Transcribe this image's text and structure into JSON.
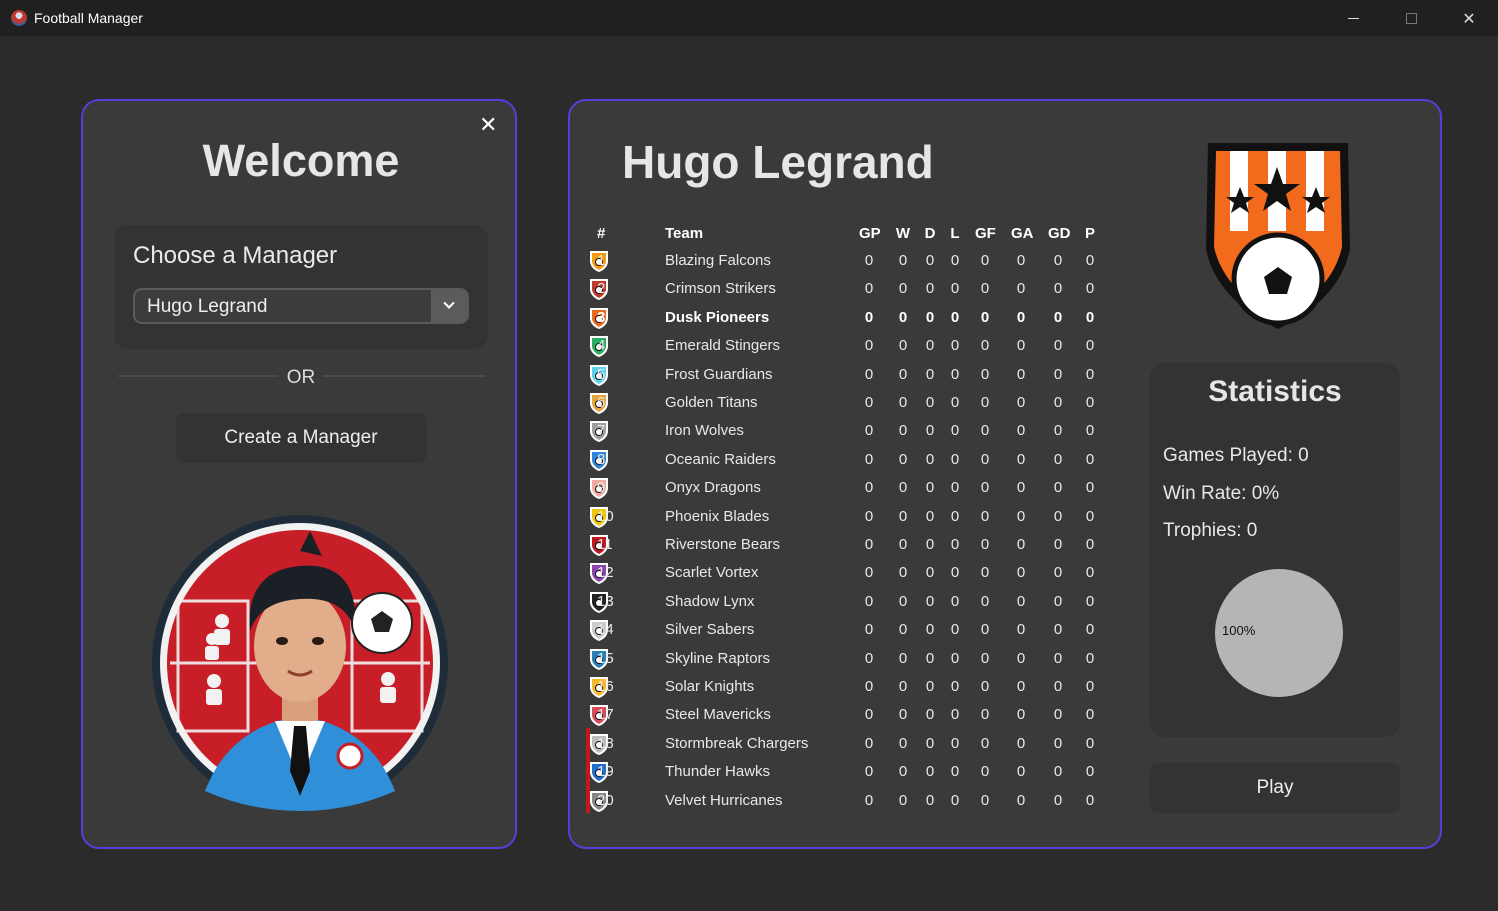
{
  "window": {
    "title": "Football Manager"
  },
  "welcome": {
    "heading": "Welcome",
    "choose_title": "Choose a Manager",
    "selected_manager": "Hugo Legrand",
    "or_text": "OR",
    "create_button": "Create a Manager"
  },
  "profile": {
    "manager_name": "Hugo Legrand",
    "table": {
      "headers": [
        "#",
        "Team",
        "GP",
        "W",
        "D",
        "L",
        "GF",
        "GA",
        "GD",
        "P"
      ],
      "rows": [
        {
          "pos": "1",
          "team": "Blazing Falcons",
          "gp": "0",
          "w": "0",
          "d": "0",
          "l": "0",
          "gf": "0",
          "ga": "0",
          "gd": "0",
          "p": "0",
          "color": "#f39c12"
        },
        {
          "pos": "2",
          "team": "Crimson Strikers",
          "gp": "0",
          "w": "0",
          "d": "0",
          "l": "0",
          "gf": "0",
          "ga": "0",
          "gd": "0",
          "p": "0",
          "color": "#c0392b"
        },
        {
          "pos": "3",
          "team": "Dusk Pioneers",
          "gp": "0",
          "w": "0",
          "d": "0",
          "l": "0",
          "gf": "0",
          "ga": "0",
          "gd": "0",
          "p": "0",
          "color": "#e8691f"
        },
        {
          "pos": "4",
          "team": "Emerald Stingers",
          "gp": "0",
          "w": "0",
          "d": "0",
          "l": "0",
          "gf": "0",
          "ga": "0",
          "gd": "0",
          "p": "0",
          "color": "#27ae60"
        },
        {
          "pos": "5",
          "team": "Frost Guardians",
          "gp": "0",
          "w": "0",
          "d": "0",
          "l": "0",
          "gf": "0",
          "ga": "0",
          "gd": "0",
          "p": "0",
          "color": "#5dd3f0"
        },
        {
          "pos": "6",
          "team": "Golden Titans",
          "gp": "0",
          "w": "0",
          "d": "0",
          "l": "0",
          "gf": "0",
          "ga": "0",
          "gd": "0",
          "p": "0",
          "color": "#e8a33d"
        },
        {
          "pos": "7",
          "team": "Iron Wolves",
          "gp": "0",
          "w": "0",
          "d": "0",
          "l": "0",
          "gf": "0",
          "ga": "0",
          "gd": "0",
          "p": "0",
          "color": "#9e9e9e"
        },
        {
          "pos": "8",
          "team": "Oceanic Raiders",
          "gp": "0",
          "w": "0",
          "d": "0",
          "l": "0",
          "gf": "0",
          "ga": "0",
          "gd": "0",
          "p": "0",
          "color": "#2e86de"
        },
        {
          "pos": "9",
          "team": "Onyx Dragons",
          "gp": "0",
          "w": "0",
          "d": "0",
          "l": "0",
          "gf": "0",
          "ga": "0",
          "gd": "0",
          "p": "0",
          "color": "#f1a9a0"
        },
        {
          "pos": "10",
          "team": "Phoenix Blades",
          "gp": "0",
          "w": "0",
          "d": "0",
          "l": "0",
          "gf": "0",
          "ga": "0",
          "gd": "0",
          "p": "0",
          "color": "#f1c40f"
        },
        {
          "pos": "11",
          "team": "Riverstone Bears",
          "gp": "0",
          "w": "0",
          "d": "0",
          "l": "0",
          "gf": "0",
          "ga": "0",
          "gd": "0",
          "p": "0",
          "color": "#c0181f"
        },
        {
          "pos": "12",
          "team": "Scarlet Vortex",
          "gp": "0",
          "w": "0",
          "d": "0",
          "l": "0",
          "gf": "0",
          "ga": "0",
          "gd": "0",
          "p": "0",
          "color": "#8e44ad"
        },
        {
          "pos": "13",
          "team": "Shadow Lynx",
          "gp": "0",
          "w": "0",
          "d": "0",
          "l": "0",
          "gf": "0",
          "ga": "0",
          "gd": "0",
          "p": "0",
          "color": "#222222"
        },
        {
          "pos": "14",
          "team": "Silver Sabers",
          "gp": "0",
          "w": "0",
          "d": "0",
          "l": "0",
          "gf": "0",
          "ga": "0",
          "gd": "0",
          "p": "0",
          "color": "#cccccc"
        },
        {
          "pos": "15",
          "team": "Skyline Raptors",
          "gp": "0",
          "w": "0",
          "d": "0",
          "l": "0",
          "gf": "0",
          "ga": "0",
          "gd": "0",
          "p": "0",
          "color": "#2980b9"
        },
        {
          "pos": "16",
          "team": "Solar Knights",
          "gp": "0",
          "w": "0",
          "d": "0",
          "l": "0",
          "gf": "0",
          "ga": "0",
          "gd": "0",
          "p": "0",
          "color": "#f5b82e"
        },
        {
          "pos": "17",
          "team": "Steel Mavericks",
          "gp": "0",
          "w": "0",
          "d": "0",
          "l": "0",
          "gf": "0",
          "ga": "0",
          "gd": "0",
          "p": "0",
          "color": "#d94c5a"
        },
        {
          "pos": "18",
          "team": "Stormbreak Chargers",
          "gp": "0",
          "w": "0",
          "d": "0",
          "l": "0",
          "gf": "0",
          "ga": "0",
          "gd": "0",
          "p": "0",
          "color": "#bdbdbd"
        },
        {
          "pos": "19",
          "team": "Thunder Hawks",
          "gp": "0",
          "w": "0",
          "d": "0",
          "l": "0",
          "gf": "0",
          "ga": "0",
          "gd": "0",
          "p": "0",
          "color": "#1f6fd1"
        },
        {
          "pos": "20",
          "team": "Velvet Hurricanes",
          "gp": "0",
          "w": "0",
          "d": "0",
          "l": "0",
          "gf": "0",
          "ga": "0",
          "gd": "0",
          "p": "0",
          "color": "#888888"
        }
      ],
      "highlight_position": "3"
    },
    "statistics": {
      "title": "Statistics",
      "games_played": "Games Played: 0",
      "win_rate": "Win Rate: 0%",
      "trophies": "Trophies: 0",
      "pie_label": "100%",
      "pie_color": "#b5b5b5"
    },
    "play_button": "Play"
  },
  "colors": {
    "accent_border": "#5140d9",
    "relegation": "#c0181f",
    "team_crest_orange": "#f26a1b"
  }
}
